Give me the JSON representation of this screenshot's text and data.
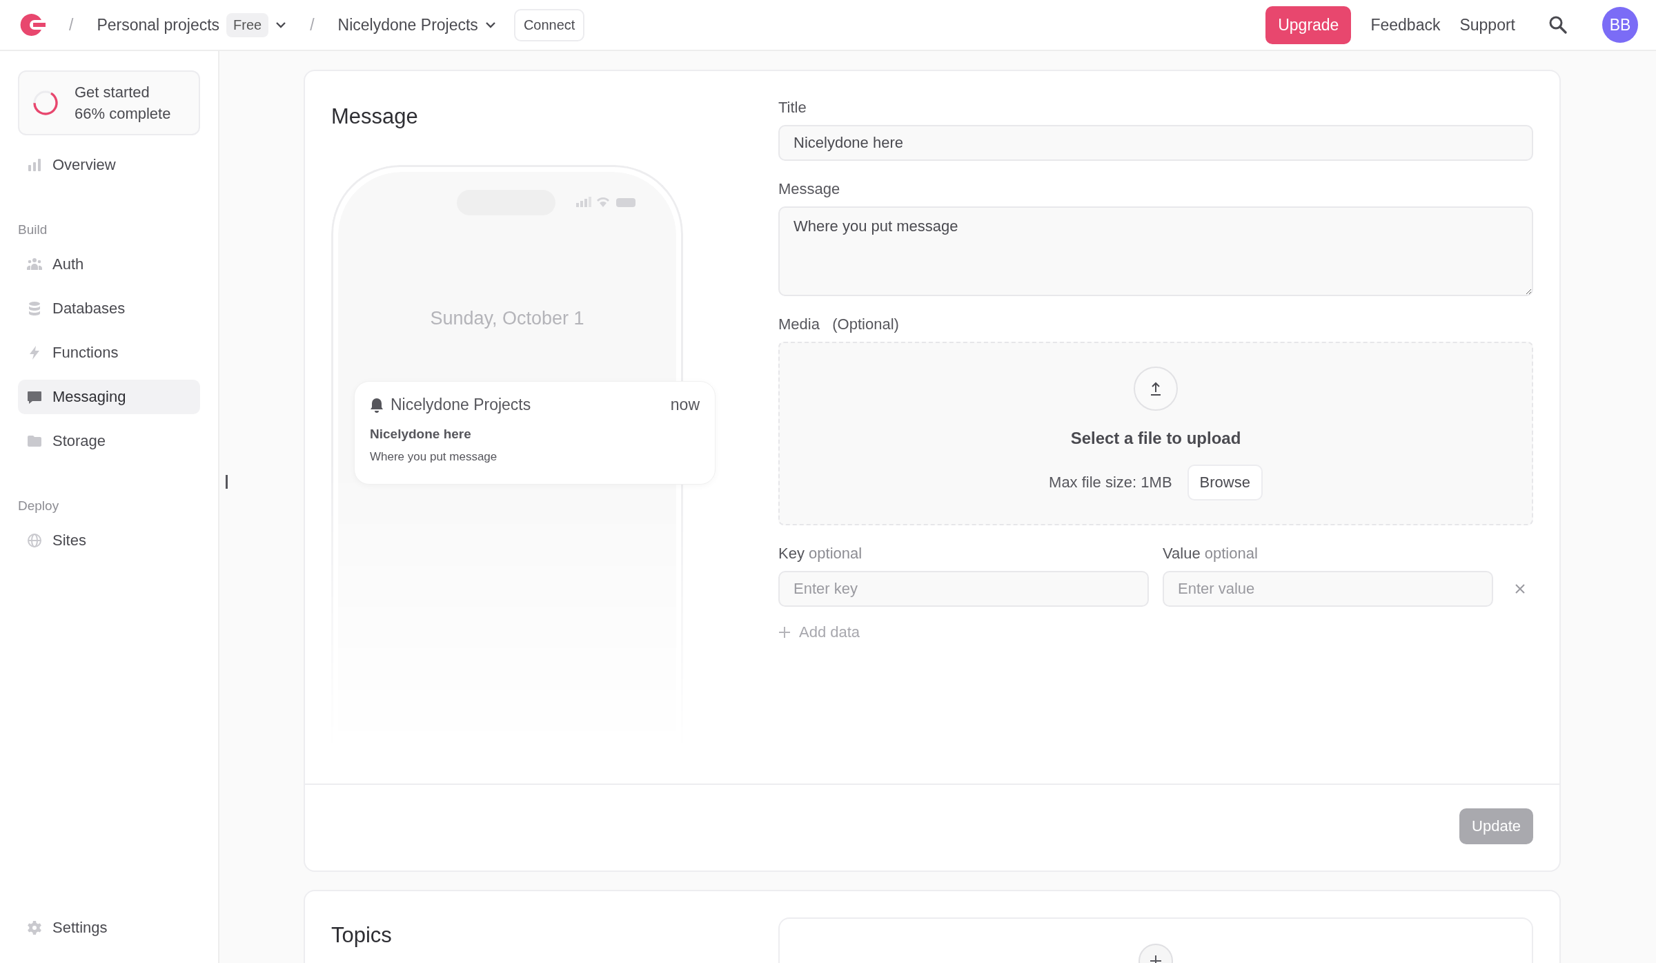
{
  "topbar": {
    "breadcrumbs": [
      {
        "separator": "/",
        "label": "Personal projects",
        "badge": "Free",
        "dropdown": true
      },
      {
        "separator": "/",
        "label": "Nicelydone Projects",
        "dropdown": true
      }
    ],
    "connect": "Connect",
    "upgrade": "Upgrade",
    "links": [
      "Feedback",
      "Support"
    ],
    "avatar": "BB"
  },
  "sidebar": {
    "progress": {
      "title": "Get started",
      "subtitle": "66% complete",
      "level": 0.66
    },
    "sections": [
      {
        "items": [
          {
            "label": "Overview",
            "selected": false
          }
        ]
      },
      {
        "heading": "Build",
        "items": [
          {
            "label": "Auth",
            "selected": false
          },
          {
            "label": "Databases",
            "selected": false
          },
          {
            "label": "Functions",
            "selected": false
          },
          {
            "label": "Messaging",
            "selected": true
          },
          {
            "label": "Storage",
            "selected": false
          }
        ]
      },
      {
        "heading": "Deploy",
        "items": [
          {
            "label": "Sites",
            "selected": false
          }
        ]
      }
    ],
    "footer": {
      "label": "Settings",
      "selected": false
    }
  },
  "message_card": {
    "title": "Message",
    "preview": {
      "date": "Sunday, October 1",
      "notification": {
        "app": "Nicelydone Projects",
        "time": "now",
        "title": "Nicelydone here",
        "body": "Where you put message"
      }
    },
    "form": {
      "title_field": {
        "label": "Title",
        "value": "Nicelydone here"
      },
      "message_field": {
        "label": "Message",
        "value": "Where you put message"
      },
      "media": {
        "label": "Media",
        "hint": "(Optional)",
        "prompt": "Select a file to upload",
        "max_size": "Max file size: 1MB",
        "browse": "Browse"
      },
      "data_rows": [
        {
          "key_label": "Key",
          "key_hint": "optional",
          "key_placeholder": "Enter key",
          "value_label": "Value",
          "value_hint": "optional",
          "value_placeholder": "Enter value"
        }
      ],
      "add_data": "Add data"
    },
    "update": {
      "label": "Update",
      "disabled": true
    }
  },
  "topics_card": {
    "title": "Topics"
  }
}
